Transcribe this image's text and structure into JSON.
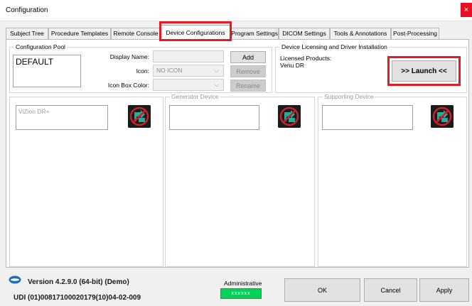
{
  "window": {
    "title": "Configuration",
    "close_glyph": "×"
  },
  "tabs": [
    {
      "label": "Subject Tree",
      "active": false
    },
    {
      "label": "Procedure Templates",
      "active": false
    },
    {
      "label": "Remote Console",
      "active": false
    },
    {
      "label": "Device Configurations",
      "active": true
    },
    {
      "label": "Program Settings",
      "active": false
    },
    {
      "label": "DICOM Settings",
      "active": false
    },
    {
      "label": "Tools & Annotations",
      "active": false
    },
    {
      "label": "Post-Processing",
      "active": false
    }
  ],
  "config_pool": {
    "title": "Configuration Pool",
    "items": [
      "DEFAULT"
    ],
    "display_name_label": "Display Name:",
    "display_name_value": "",
    "icon_label": "Icon:",
    "icon_value": "NO ICON",
    "icon_box_color_label": "Icon Box Color:",
    "icon_box_color_value": "",
    "add_label": "Add",
    "remove_label": "Remove",
    "rename_label": "Rename"
  },
  "licensing": {
    "title": "Device Licensing and Driver Installation",
    "licensed_products_label": "Licensed Products:",
    "product": "Venu DR",
    "launch_label": ">> Launch <<"
  },
  "device_slots": {
    "primary_value": "ViZion DR+",
    "generator_title": "Generator Device",
    "generator_value": "",
    "supporting_title": "Supporting Device",
    "supporting_value": ""
  },
  "status": {
    "version": "Version 4.2.9.0 (64-bit) (Demo)",
    "udi": "UDI (01)00817100020179(10)04-02-009",
    "role_label": "Administrative",
    "role_badge": "xxxxxx"
  },
  "buttons": {
    "ok": "OK",
    "cancel": "Cancel",
    "apply": "Apply"
  },
  "colors": {
    "highlight": "#e31b23",
    "badge": "#00d35a",
    "logo": "#1f6fb8"
  },
  "icons": [
    "close-icon",
    "chevron-down-icon",
    "device-icon",
    "vizion-logo-icon"
  ]
}
